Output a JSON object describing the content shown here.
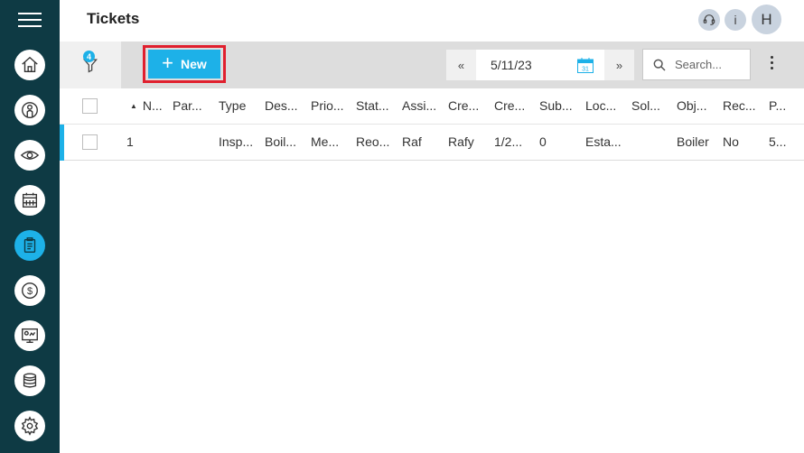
{
  "sidebar": {
    "items": [
      {
        "name": "home",
        "icon": "home-icon"
      },
      {
        "name": "contacts",
        "icon": "person-icon"
      },
      {
        "name": "overview",
        "icon": "eye-icon"
      },
      {
        "name": "calendar",
        "icon": "calendar-icon"
      },
      {
        "name": "tickets",
        "icon": "clipboard-icon",
        "active": true
      },
      {
        "name": "finance",
        "icon": "dollar-icon"
      },
      {
        "name": "dashboard",
        "icon": "monitor-icon"
      },
      {
        "name": "database",
        "icon": "database-icon"
      },
      {
        "name": "settings",
        "icon": "gear-icon"
      }
    ]
  },
  "header": {
    "title": "Tickets",
    "info_label": "i",
    "avatar_initial": "H"
  },
  "toolbar": {
    "filter_count": "4",
    "new_label": "New",
    "prev_label": "«",
    "next_label": "»",
    "date_value": "5/11/23",
    "calendar_day": "31",
    "search_placeholder": "Search..."
  },
  "table": {
    "columns": [
      "N...",
      "Par...",
      "Type",
      "Des...",
      "Prio...",
      "Stat...",
      "Assi...",
      "Cre...",
      "Cre...",
      "Sub...",
      "Loc...",
      "Sol...",
      "Obj...",
      "Rec...",
      "P..."
    ],
    "rows": [
      [
        "1",
        "",
        "Insp...",
        "Boil...",
        "Me...",
        "Reo...",
        "Raf",
        "Rafy",
        "1/2...",
        "0",
        "Esta...",
        "",
        "Boiler",
        "No",
        "5..."
      ]
    ]
  },
  "colors": {
    "sidebar_bg": "#0e3a44",
    "accent": "#1db1e8",
    "highlight_outline": "#e0202e"
  }
}
